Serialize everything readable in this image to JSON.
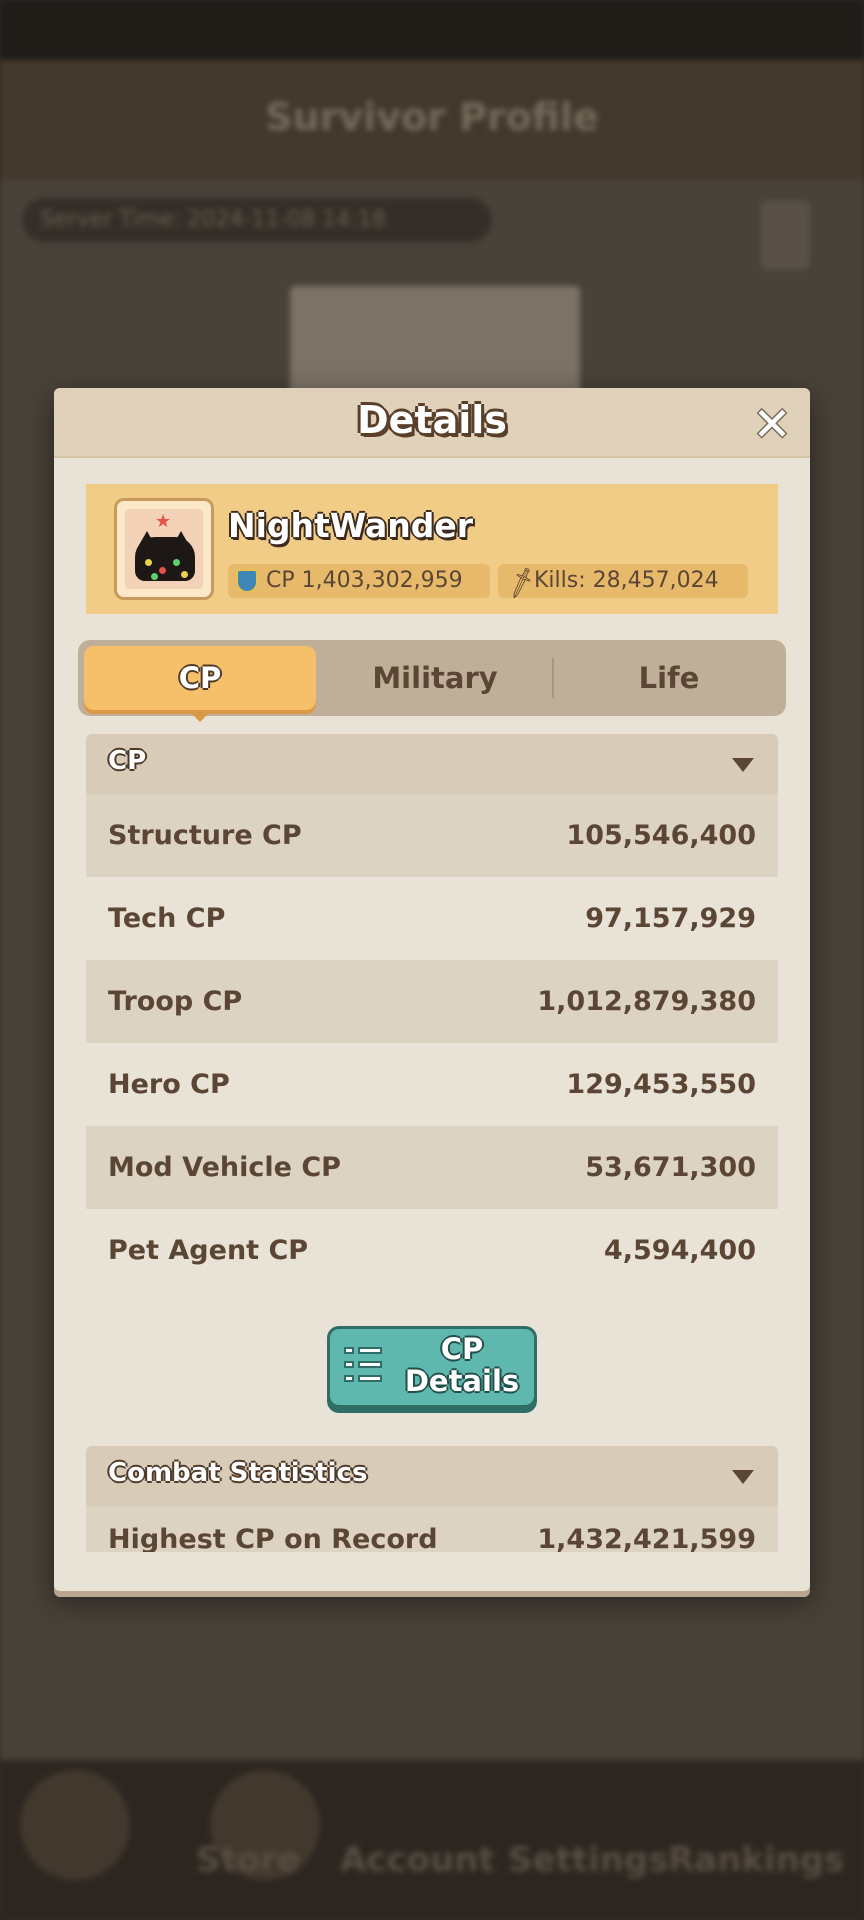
{
  "background": {
    "title": "Survivor Profile",
    "time_label": "Server Time: 2024-11-08 14:18",
    "nav": [
      "Store",
      "Account",
      "Settings",
      "Rankings"
    ]
  },
  "dialog": {
    "title": "Details",
    "close_icon": "close-icon"
  },
  "profile": {
    "name": "NightWander",
    "cp_label": "CP 1,403,302,959",
    "kills_label": "Kills:",
    "kills_value": "28,457,024"
  },
  "tabs": [
    {
      "label": "CP",
      "active": true
    },
    {
      "label": "Military",
      "active": false
    },
    {
      "label": "Life",
      "active": false
    }
  ],
  "cp_section": {
    "title": "CP",
    "rows": [
      {
        "label": "Structure CP",
        "value": "105,546,400"
      },
      {
        "label": "Tech CP",
        "value": "97,157,929"
      },
      {
        "label": "Troop CP",
        "value": "1,012,879,380"
      },
      {
        "label": "Hero CP",
        "value": "129,453,550"
      },
      {
        "label": "Mod Vehicle CP",
        "value": "53,671,300"
      },
      {
        "label": "Pet Agent CP",
        "value": "4,594,400"
      }
    ],
    "details_button": [
      "CP",
      "Details"
    ]
  },
  "combat_section": {
    "title": "Combat Statistics",
    "rows": [
      {
        "label": "Highest CP on Record",
        "value": "1,432,421,599"
      }
    ]
  },
  "colors": {
    "accent_tab": "#f6c06a",
    "details_button": "#5fb8ad",
    "banner": "#f0cc86"
  }
}
